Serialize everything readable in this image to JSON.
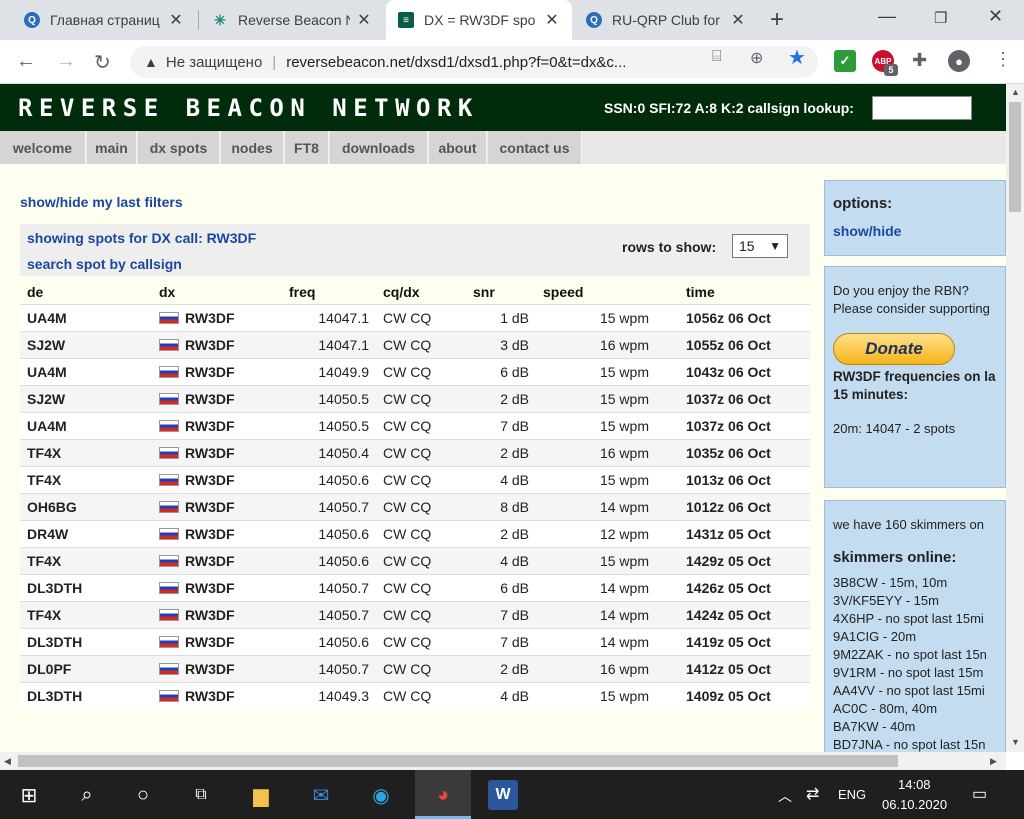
{
  "browser": {
    "tabs": [
      {
        "title": "Главная страниц",
        "favicon": "qrz-icon"
      },
      {
        "title": "Reverse Beacon N",
        "favicon": "rbn-icon"
      },
      {
        "title": "DX = RW3DF spo",
        "favicon": "rbn-icon"
      },
      {
        "title": "RU-QRP Club for",
        "favicon": "qrz-icon"
      }
    ],
    "address": {
      "security": "Не защищено",
      "url": "reversebeacon.net/dxsd1/dxsd1.php?f=0&t=dx&c..."
    },
    "extension_badge": "5"
  },
  "site": {
    "logo": "REVERSE BEACON NETWORK",
    "solar": "SSN:0 SFI:72 A:8 K:2 callsign lookup:",
    "menu": [
      "welcome",
      "main",
      "dx spots",
      "nodes",
      "FT8",
      "downloads",
      "about",
      "contact us"
    ]
  },
  "main": {
    "last_filters": "show/hide my last filters",
    "showing": "showing spots for DX call: RW3DF",
    "search": "search spot by callsign",
    "rows_label": "rows to show:",
    "rows_value": "15",
    "columns": [
      "de",
      "dx",
      "freq",
      "cq/dx",
      "snr",
      "speed",
      "time"
    ],
    "rows": [
      {
        "de": "UA4M",
        "dx": "RW3DF",
        "freq": "14047.1",
        "mode": "CW CQ",
        "snr": "1 dB",
        "speed": "15 wpm",
        "time": "1056z 06 Oct"
      },
      {
        "de": "SJ2W",
        "dx": "RW3DF",
        "freq": "14047.1",
        "mode": "CW CQ",
        "snr": "3 dB",
        "speed": "16 wpm",
        "time": "1055z 06 Oct"
      },
      {
        "de": "UA4M",
        "dx": "RW3DF",
        "freq": "14049.9",
        "mode": "CW CQ",
        "snr": "6 dB",
        "speed": "15 wpm",
        "time": "1043z 06 Oct"
      },
      {
        "de": "SJ2W",
        "dx": "RW3DF",
        "freq": "14050.5",
        "mode": "CW CQ",
        "snr": "2 dB",
        "speed": "15 wpm",
        "time": "1037z 06 Oct"
      },
      {
        "de": "UA4M",
        "dx": "RW3DF",
        "freq": "14050.5",
        "mode": "CW CQ",
        "snr": "7 dB",
        "speed": "15 wpm",
        "time": "1037z 06 Oct"
      },
      {
        "de": "TF4X",
        "dx": "RW3DF",
        "freq": "14050.4",
        "mode": "CW CQ",
        "snr": "2 dB",
        "speed": "16 wpm",
        "time": "1035z 06 Oct"
      },
      {
        "de": "TF4X",
        "dx": "RW3DF",
        "freq": "14050.6",
        "mode": "CW CQ",
        "snr": "4 dB",
        "speed": "15 wpm",
        "time": "1013z 06 Oct"
      },
      {
        "de": "OH6BG",
        "dx": "RW3DF",
        "freq": "14050.7",
        "mode": "CW CQ",
        "snr": "8 dB",
        "speed": "14 wpm",
        "time": "1012z 06 Oct"
      },
      {
        "de": "DR4W",
        "dx": "RW3DF",
        "freq": "14050.6",
        "mode": "CW CQ",
        "snr": "2 dB",
        "speed": "12 wpm",
        "time": "1431z 05 Oct"
      },
      {
        "de": "TF4X",
        "dx": "RW3DF",
        "freq": "14050.6",
        "mode": "CW CQ",
        "snr": "4 dB",
        "speed": "15 wpm",
        "time": "1429z 05 Oct"
      },
      {
        "de": "DL3DTH",
        "dx": "RW3DF",
        "freq": "14050.7",
        "mode": "CW CQ",
        "snr": "6 dB",
        "speed": "14 wpm",
        "time": "1426z 05 Oct"
      },
      {
        "de": "TF4X",
        "dx": "RW3DF",
        "freq": "14050.7",
        "mode": "CW CQ",
        "snr": "7 dB",
        "speed": "14 wpm",
        "time": "1424z 05 Oct"
      },
      {
        "de": "DL3DTH",
        "dx": "RW3DF",
        "freq": "14050.6",
        "mode": "CW CQ",
        "snr": "7 dB",
        "speed": "14 wpm",
        "time": "1419z 05 Oct"
      },
      {
        "de": "DL0PF",
        "dx": "RW3DF",
        "freq": "14050.7",
        "mode": "CW CQ",
        "snr": "2 dB",
        "speed": "16 wpm",
        "time": "1412z 05 Oct"
      },
      {
        "de": "DL3DTH",
        "dx": "RW3DF",
        "freq": "14049.3",
        "mode": "CW CQ",
        "snr": "4 dB",
        "speed": "15 wpm",
        "time": "1409z 05 Oct"
      }
    ]
  },
  "sidebar": {
    "options_title": "options:",
    "options_link": "show/hide",
    "enjoy_line1": "Do you enjoy the RBN?",
    "enjoy_line2": "Please consider supporting",
    "donate": "Donate",
    "freq_title1": "RW3DF frequencies on la",
    "freq_title2": "15 minutes:",
    "freq_line": "20m: 14047 - 2 spots",
    "skimmers_count": "we have 160 skimmers on",
    "skimmers_title": "skimmers online:",
    "skimmers": [
      "3B8CW - 15m, 10m",
      "3V/KF5EYY - 15m",
      "4X6HP - no spot last 15mi",
      "9A1CIG - 20m",
      "9M2ZAK - no spot last 15n",
      "9V1RM - no spot last 15m",
      "AA4VV - no spot last 15mi",
      "AC0C - 80m, 40m",
      "BA7KW - 40m",
      "BD7JNA - no spot last 15n"
    ]
  },
  "taskbar": {
    "lang": "ENG",
    "time": "14:08",
    "date": "06.10.2020"
  }
}
